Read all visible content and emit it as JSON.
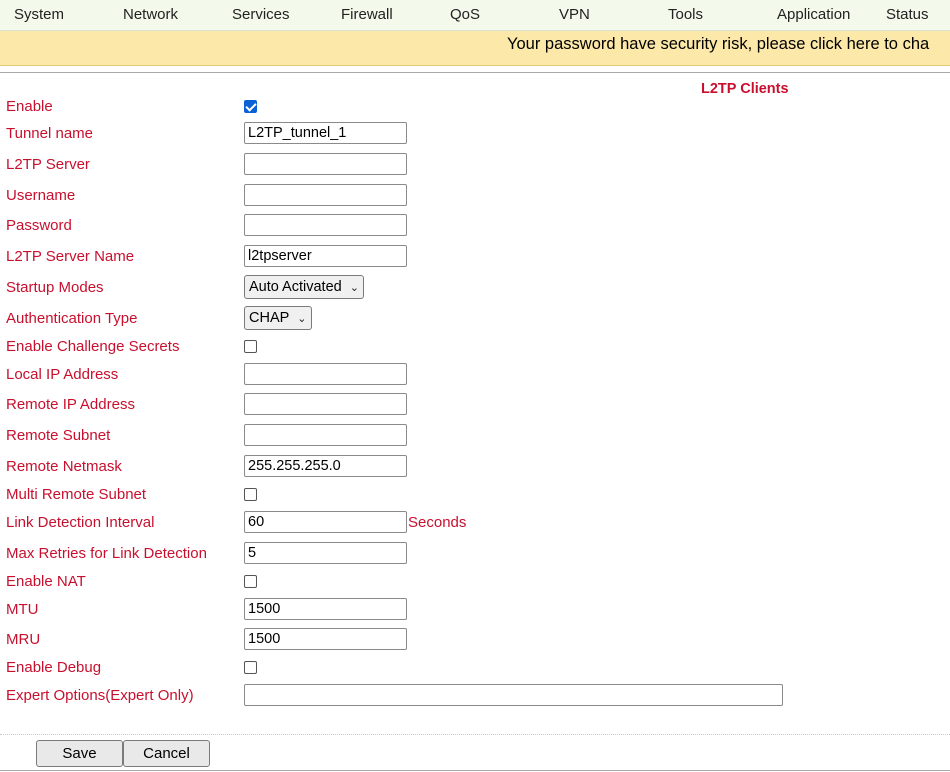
{
  "nav": {
    "items": [
      "System",
      "Network",
      "Services",
      "Firewall",
      "QoS",
      "VPN",
      "Tools",
      "Application",
      "Status"
    ]
  },
  "banner": {
    "text": "Your password have security risk, please click here to cha"
  },
  "section": {
    "title": "L2TP Clients"
  },
  "rows": [
    {
      "key": "enable",
      "label": "Enable",
      "control": "checkbox",
      "checked": true
    },
    {
      "key": "tunnel-name",
      "label": "Tunnel name",
      "control": "text",
      "value": "L2TP_tunnel_1"
    },
    {
      "key": "l2tp-server",
      "label": "L2TP Server",
      "control": "text",
      "value": ""
    },
    {
      "key": "username",
      "label": "Username",
      "control": "text",
      "value": ""
    },
    {
      "key": "password",
      "label": "Password",
      "control": "text",
      "value": ""
    },
    {
      "key": "l2tp-server-name",
      "label": "L2TP Server Name",
      "control": "text",
      "value": "l2tpserver"
    },
    {
      "key": "startup-modes",
      "label": "Startup Modes",
      "control": "select",
      "value": "Auto Activated"
    },
    {
      "key": "authentication-type",
      "label": "Authentication Type",
      "control": "select",
      "value": "CHAP"
    },
    {
      "key": "enable-challenge-secrets",
      "label": "Enable Challenge Secrets",
      "control": "checkbox",
      "checked": false
    },
    {
      "key": "local-ip-address",
      "label": "Local IP Address",
      "control": "text",
      "value": ""
    },
    {
      "key": "remote-ip-address",
      "label": "Remote IP Address",
      "control": "text",
      "value": ""
    },
    {
      "key": "remote-subnet",
      "label": "Remote Subnet",
      "control": "text",
      "value": ""
    },
    {
      "key": "remote-netmask",
      "label": "Remote Netmask",
      "control": "text",
      "value": "255.255.255.0"
    },
    {
      "key": "multi-remote-subnet",
      "label": "Multi Remote Subnet",
      "control": "checkbox",
      "checked": false
    },
    {
      "key": "link-detection-interval",
      "label": "Link Detection Interval",
      "control": "text",
      "value": "60",
      "unit": "Seconds"
    },
    {
      "key": "max-retries-link-detection",
      "label": "Max Retries for Link Detection",
      "control": "text",
      "value": "5"
    },
    {
      "key": "enable-nat",
      "label": "Enable NAT",
      "control": "checkbox",
      "checked": false
    },
    {
      "key": "mtu",
      "label": "MTU",
      "control": "text",
      "value": "1500"
    },
    {
      "key": "mru",
      "label": "MRU",
      "control": "text",
      "value": "1500"
    },
    {
      "key": "enable-debug",
      "label": "Enable Debug",
      "control": "checkbox",
      "checked": false
    },
    {
      "key": "expert-options",
      "label": "Expert Options(Expert Only)",
      "control": "text-wide",
      "value": ""
    }
  ],
  "buttons": {
    "save": "Save",
    "cancel": "Cancel"
  },
  "colors": {
    "label": "#c8102e",
    "nav_bg": "#f3f9eb",
    "banner_bg": "#fce8a8",
    "checkbox_checked": "#0b62d6"
  }
}
